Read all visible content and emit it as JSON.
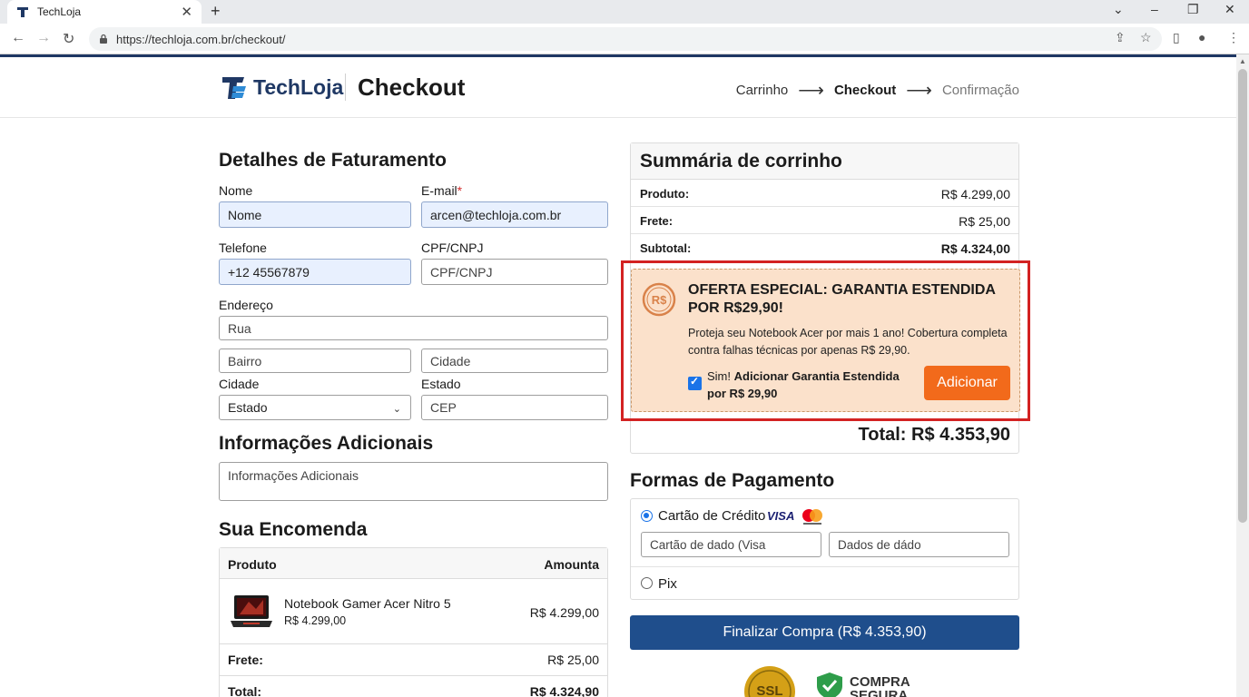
{
  "browser": {
    "tab_title": "TechLoja",
    "url": "https://techloja.com.br/checkout/"
  },
  "header": {
    "brand": "TechLoja",
    "page_title": "Checkout",
    "steps": [
      "Carrinho",
      "Checkout",
      "Confirmação"
    ],
    "arrow": "⟶"
  },
  "billing": {
    "title": "Detalhes de Faturamento",
    "name_label": "Nome",
    "name_value": "Nome",
    "email_label": "E-mail",
    "email_required": "*",
    "email_value": "arcen@techloja.com.br",
    "phone_label": "Telefone",
    "phone_value": "+12 45567879",
    "cpf_label": "CPF/CNPJ",
    "cpf_placeholder": "CPF/CNPJ",
    "address_label": "Endereço",
    "street_placeholder": "Rua",
    "district_placeholder": "Bairro",
    "city_placeholder": "Cidade",
    "city_label": "Cidade",
    "state_label": "Estado",
    "state_selected": "Estado",
    "cep_placeholder": "CEP"
  },
  "additional": {
    "title": "Informações Adicionais",
    "placeholder": "Informações Adicionais"
  },
  "order": {
    "title": "Sua Encomenda",
    "col_product": "Produto",
    "col_amount": "Amounta",
    "item_name": "Notebook Gamer Acer Nitro 5",
    "item_unit_price": "R$ 4.299,00",
    "item_total": "R$ 4.299,00",
    "shipping_label": "Frete:",
    "shipping_value": "R$ 25,00",
    "total_label": "Total:",
    "total_value": "R$ 4.324,90"
  },
  "summary": {
    "title": "Summária de corrinho",
    "product_label": "Produto:",
    "product_value": "R$ 4.299,00",
    "shipping_label": "Frete:",
    "shipping_value": "R$ 25,00",
    "subtotal_label": "Subtotal:",
    "subtotal_value": "R$ 4.324,00",
    "total": "Total: R$ 4.353,90"
  },
  "offer": {
    "coin_text": "R$",
    "title": "OFERTA ESPECIAL: GARANTIA ESTENDIDA POR R$29,90!",
    "description": "Proteja seu Notebook Acer por mais 1 ano! Cobertura completa contra falhas técnicas por apenas R$ 29,90.",
    "checkbox_prefix": "Sim! ",
    "checkbox_label": "Adicionar Garantia Estendida por R$ 29,90",
    "checked": true,
    "button": "Adicionar"
  },
  "payment": {
    "title": "Formas de Pagamento",
    "credit_label": "Cartão de Crédito",
    "visa": "VISA",
    "card_placeholder": "Cartão de dado (Visa",
    "data_placeholder": "Dados de dádo",
    "pix_label": "Pix"
  },
  "finalize_button": "Finalizar Compra (R$ 4.353,90)",
  "badges": {
    "ssl": "SSL",
    "secure": "COMPRA SEGURA"
  },
  "colors": {
    "brand": "#1f3864",
    "accent_orange": "#f26a1b",
    "finalize_blue": "#1f4e8c",
    "highlight_red": "#d32222"
  }
}
